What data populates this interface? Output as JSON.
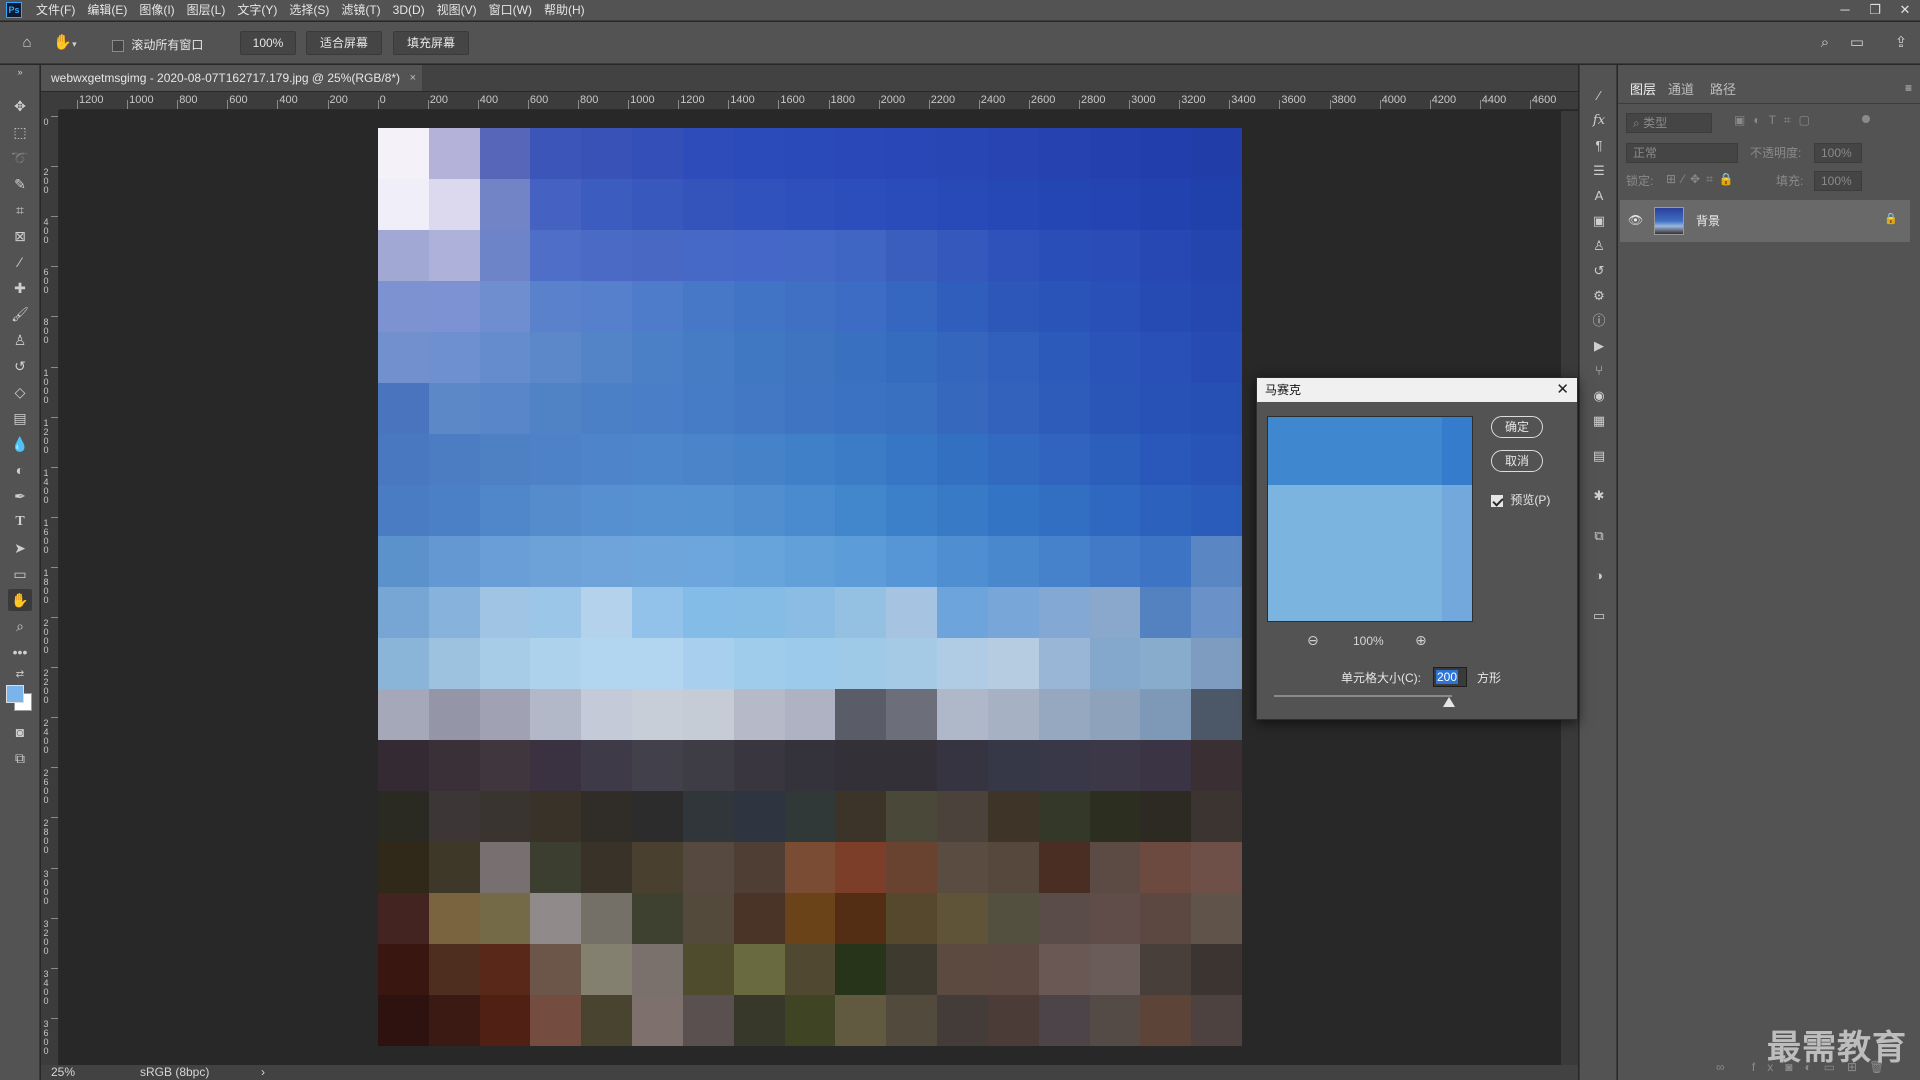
{
  "menubar": {
    "logo": "Ps",
    "items": [
      "文件(F)",
      "编辑(E)",
      "图像(I)",
      "图层(L)",
      "文字(Y)",
      "选择(S)",
      "滤镜(T)",
      "3D(D)",
      "视图(V)",
      "窗口(W)",
      "帮助(H)"
    ],
    "win_min": "─",
    "win_restore": "❐",
    "win_close": "✕"
  },
  "optbar": {
    "scroll_all_windows": "滚动所有窗口",
    "zoom_100": "100%",
    "fit_screen": "适合屏幕",
    "fill_screen": "填充屏幕"
  },
  "document": {
    "tab_title": "webwxgetmsgimg - 2020-08-07T162717.179.jpg @ 25%(RGB/8*)",
    "close": "×",
    "ruler_h_labels": [
      "1200",
      "1000",
      "800",
      "600",
      "400",
      "200",
      "0",
      "200",
      "400",
      "600",
      "800",
      "1000",
      "1200",
      "1400",
      "1600",
      "1800",
      "2000",
      "2200",
      "2400",
      "2600",
      "2800",
      "3000",
      "3200",
      "3400",
      "3600",
      "3800",
      "4000",
      "4200",
      "4400",
      "4600"
    ],
    "ruler_v_labels": [
      "0",
      "200",
      "400",
      "600",
      "800",
      "1000",
      "1200",
      "1400",
      "1600",
      "1800",
      "2000",
      "2200",
      "2400",
      "2600",
      "2800",
      "3000",
      "3200",
      "3400",
      "3600"
    ]
  },
  "status": {
    "zoom": "25%",
    "color_profile": "sRGB (8bpc)",
    "arrow": "›"
  },
  "mosaic": {
    "cols": 17,
    "rows": [
      [
        "#f4f2f8",
        "#b4b2d8",
        "#5766b8",
        "#3b55b8",
        "#3852b8",
        "#354fb8",
        "#2f4dba",
        "#2b4bba",
        "#2a4aba",
        "#2a48b8",
        "#2947b6",
        "#2846b4",
        "#2744b2",
        "#2642b0",
        "#2440ae",
        "#223eac",
        "#213da8"
      ],
      [
        "#f0eef8",
        "#dcd8ee",
        "#7384c6",
        "#4562c2",
        "#3d5cc0",
        "#3858be",
        "#3454bc",
        "#2f52bc",
        "#2e50bc",
        "#2c4ebc",
        "#2a4cba",
        "#284ab8",
        "#2648b6",
        "#2446b4",
        "#2344b2",
        "#2242b0",
        "#2040ac"
      ],
      [
        "#a2a8d4",
        "#aeb2da",
        "#6d84c8",
        "#4e6ec8",
        "#4a6ac6",
        "#4868c4",
        "#4668c6",
        "#4568c8",
        "#4468c6",
        "#3f66c2",
        "#3a5ebe",
        "#3458bc",
        "#2e52ba",
        "#2a4eb8",
        "#2a4cb6",
        "#2748b2",
        "#2444ae"
      ],
      [
        "#7d92d0",
        "#7c92d2",
        "#6e8ed0",
        "#5a82cc",
        "#5680cc",
        "#4f7cca",
        "#4778c8",
        "#4274c6",
        "#3f70c4",
        "#3c6cc4",
        "#3566c0",
        "#305ebc",
        "#2d58ba",
        "#2a54b8",
        "#2850b6",
        "#264cb4",
        "#2448b0"
      ],
      [
        "#7290ce",
        "#6e90d0",
        "#658ccc",
        "#5c88ca",
        "#5484c8",
        "#4c80c6",
        "#467cc4",
        "#4078c2",
        "#3e74c0",
        "#3a70c0",
        "#366cbe",
        "#3466be",
        "#3060bc",
        "#2c5aba",
        "#2a54b8",
        "#2850b6",
        "#264cb4"
      ],
      [
        "#4a74be",
        "#5c88c8",
        "#5886c8",
        "#5082c6",
        "#4c80c6",
        "#4a7ec6",
        "#467cc6",
        "#4278c4",
        "#3e74c2",
        "#3c72c2",
        "#3a70c0",
        "#3668be",
        "#3262bc",
        "#2e5cba",
        "#2a56b8",
        "#2852b6",
        "#2650b4"
      ],
      [
        "#4a78c0",
        "#4c7cc2",
        "#4e80c4",
        "#4e82c8",
        "#4e84ca",
        "#4e86cc",
        "#4c84ca",
        "#4682c8",
        "#4080c8",
        "#3c7cc6",
        "#3676c4",
        "#3470c2",
        "#326ac0",
        "#3064be",
        "#2c5ebc",
        "#2a58ba",
        "#2854b8"
      ],
      [
        "#4a7cc4",
        "#4c80c6",
        "#5086ca",
        "#548ccc",
        "#5690d0",
        "#5692d2",
        "#5492d2",
        "#508ed0",
        "#4a8ace",
        "#4286cc",
        "#3c80ca",
        "#387ac6",
        "#3474c4",
        "#326ec2",
        "#2e68c0",
        "#2c62be",
        "#2a5cbc"
      ],
      [
        "#5c92cc",
        "#6498d2",
        "#6a9ed6",
        "#6ca2d8",
        "#6ea4da",
        "#6ea6dc",
        "#6ca6dc",
        "#68a4dc",
        "#62a0da",
        "#5c9cd8",
        "#5696d6",
        "#508ed2",
        "#4a88ce",
        "#4682cc",
        "#427ac8",
        "#3e74c4",
        "#5a86c4"
      ],
      [
        "#78a6d4",
        "#86b2dc",
        "#a0c4e4",
        "#9cc6e8",
        "#b4d2ec",
        "#92c2ea",
        "#84bce8",
        "#84bce6",
        "#8abce4",
        "#94c0e2",
        "#a6c4e2",
        "#6ea4dc",
        "#78a6d8",
        "#84a8d4",
        "#8aa8cc",
        "#5482c0",
        "#6a92c8"
      ],
      [
        "#8ab4d8",
        "#9cc2e0",
        "#a6cce8",
        "#acd2ec",
        "#b2d6ef",
        "#b2d6f0",
        "#a8d0ee",
        "#a0ccec",
        "#9ccaea",
        "#9ecae8",
        "#a4cae6",
        "#b0cce4",
        "#b6cce0",
        "#9ab6d6",
        "#84a8cc",
        "#88accc",
        "#7e9cc0"
      ],
      [
        "#a4a8b8",
        "#9496a8",
        "#a0a2b4",
        "#b2b8c8",
        "#c4cad8",
        "#c8ced8",
        "#c6ccd6",
        "#b6bac8",
        "#aeb2c2",
        "#5a5c68",
        "#6c6e7a",
        "#aeb8c8",
        "#a6b2c4",
        "#96a8c0",
        "#8ea2bc",
        "#7e98b8",
        "#4c5868"
      ],
      [
        "#342a34",
        "#3a3038",
        "#40363e",
        "#3a3240",
        "#3e3a48",
        "#42404a",
        "#3e3c44",
        "#3a3640",
        "#34323a",
        "#343038",
        "#343038",
        "#363440",
        "#363848",
        "#383848",
        "#3c3848",
        "#3a3444",
        "#3a3034"
      ],
      [
        "#2a2a22",
        "#3c3636",
        "#3a3430",
        "#383228",
        "#302c28",
        "#2c2c2c",
        "#30363a",
        "#2e3440",
        "#303838",
        "#3c3428",
        "#4a4838",
        "#4c423c",
        "#3e3428",
        "#343828",
        "#2c2e20",
        "#2c2a22",
        "#3c3430"
      ],
      [
        "#302818",
        "#3e3828",
        "#787070",
        "#3c3e30",
        "#383228",
        "#4a4030",
        "#564a40",
        "#4e3e34",
        "#7a4c34",
        "#7c3e28",
        "#6a4230",
        "#5a4c40",
        "#56483c",
        "#4a2e24",
        "#5c4a44",
        "#6c4a40",
        "#6e5048"
      ],
      [
        "#442420",
        "#7a6440",
        "#746a48",
        "#908a8a",
        "#747068",
        "#3e4030",
        "#544a3c",
        "#4a3428",
        "#6a4418",
        "#542e14",
        "#56482c",
        "#605438",
        "#545040",
        "#5a4c48",
        "#604c48",
        "#5c4840",
        "#60544a"
      ],
      [
        "#3a1610",
        "#4e2e1e",
        "#5a2818",
        "#6c564a",
        "#848070",
        "#7a706c",
        "#4e4c2c",
        "#6a6a40",
        "#504830",
        "#28341a",
        "#3e3a30",
        "#5c4a40",
        "#5c4a42",
        "#6a5854",
        "#6a5c58",
        "#483e3a",
        "#3c3430"
      ],
      [
        "#2e1210",
        "#3c1a14",
        "#502014",
        "#744c40",
        "#484430",
        "#7e706c",
        "#5a5050",
        "#38382a",
        "#3e4424",
        "#625a40",
        "#524a3c",
        "#443c38",
        "#4c3c38",
        "#4c4448",
        "#544a46",
        "#5c4438",
        "#4e4240"
      ]
    ]
  },
  "dialog": {
    "title": "马赛克",
    "close": "✕",
    "ok": "确定",
    "cancel": "取消",
    "preview_label": "预览(P)",
    "preview_checked": true,
    "zoom": "100%",
    "cell_size_label": "单元格大小(C):",
    "cell_size_value": "200",
    "unit": "方形"
  },
  "layers_panel": {
    "tabs": [
      "图层",
      "通道",
      "路径"
    ],
    "kind_filter": "类型",
    "blend_mode": "正常",
    "opacity_label": "不透明度:",
    "opacity_value": "100%",
    "lock_label": "锁定:",
    "fill_label": "填充:",
    "fill_value": "100%",
    "layer_name": "背景"
  },
  "watermark": "最需教育"
}
